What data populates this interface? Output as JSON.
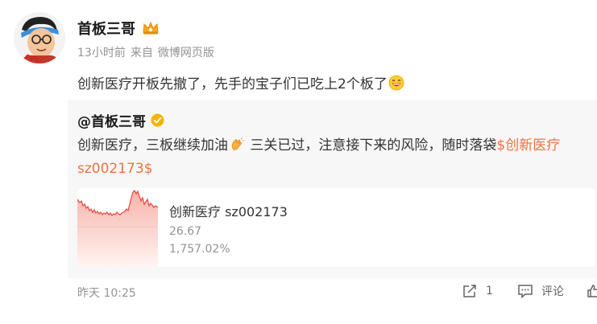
{
  "post": {
    "author": {
      "name": "首板三哥",
      "badge_icon": "crown-icon"
    },
    "meta": {
      "time": "13小时前",
      "source_prefix": "来自",
      "source": "微博网页版"
    },
    "text": "创新医疗开板先撤了，先手的宝子们已吃上2个板了",
    "text_emoji": "laughing-emoji-icon"
  },
  "repost": {
    "author": {
      "name": "@首板三哥",
      "verified_icon": "verified-icon"
    },
    "text_part1": "创新医疗，三板继续加油",
    "inline_emoji": "clap-emoji-icon",
    "text_part2": " 三关已过，注意接下来的风险，随时落袋",
    "stock_tag": "$创新医疗 sz002173$",
    "stock_card": {
      "name": "创新医疗 sz002173",
      "price": "26.67",
      "change": "1,757.02%"
    },
    "time": "昨天 10:25"
  },
  "actions": {
    "share_count": "1",
    "comment_label": "评论"
  },
  "colors": {
    "accent": "#eb7340",
    "muted": "#939393",
    "repost_bg": "#f7f7f7",
    "chart_line": "#e6453a"
  }
}
